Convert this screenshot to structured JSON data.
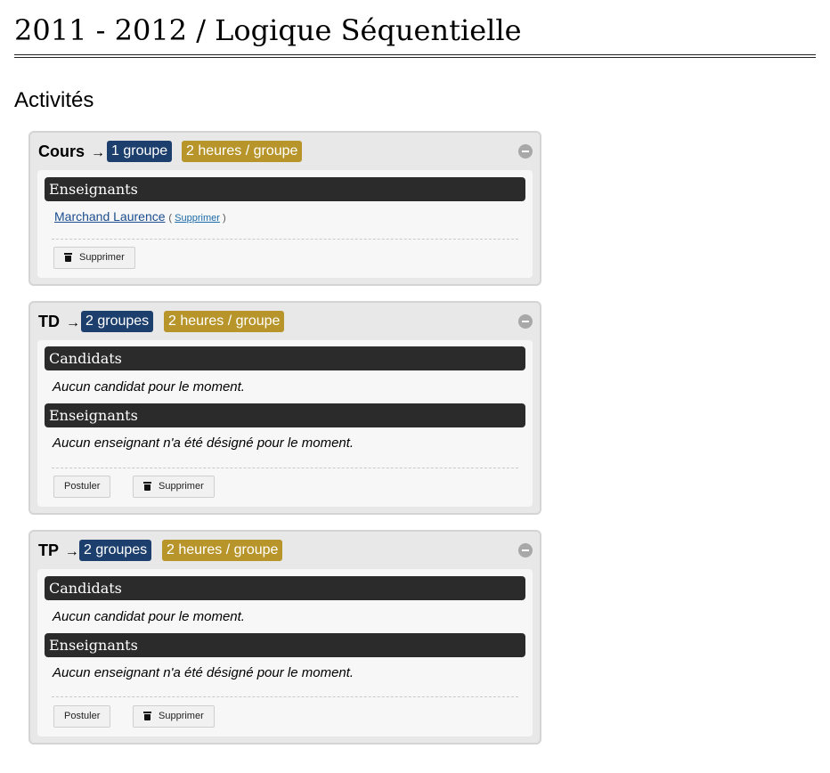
{
  "page": {
    "title": "2011 - 2012 / Logique Séquentielle"
  },
  "activities_section": {
    "title": "Activités"
  },
  "labels": {
    "arrow": "→",
    "teachers_header": "Enseignants",
    "candidates_header": "Candidats",
    "no_candidates": "Aucun candidat pour le moment.",
    "no_teachers": "Aucun enseignant n'a été désigné pour le moment.",
    "apply_button": "Postuler",
    "delete_button": "Supprimer",
    "remove_link": "Supprimer",
    "paren_open": "(",
    "paren_close": ")"
  },
  "activities": [
    {
      "name": "Cours",
      "groups_badge": "1 groupe",
      "hours_badge": "2 heures / groupe",
      "teachers": [
        {
          "name": "Marchand Laurence"
        }
      ]
    },
    {
      "name": "TD",
      "groups_badge": "2 groupes",
      "hours_badge": "2 heures / groupe"
    },
    {
      "name": "TP",
      "groups_badge": "2 groupes",
      "hours_badge": "2 heures / groupe"
    }
  ],
  "colors": {
    "groups_badge": "#1d3f6e",
    "hours_badge": "#b8952a",
    "section_header": "#2b2b2b",
    "link": "#1b4d8f"
  },
  "icons": {
    "collapse": "minus-circle-icon",
    "delete": "trash-icon"
  }
}
